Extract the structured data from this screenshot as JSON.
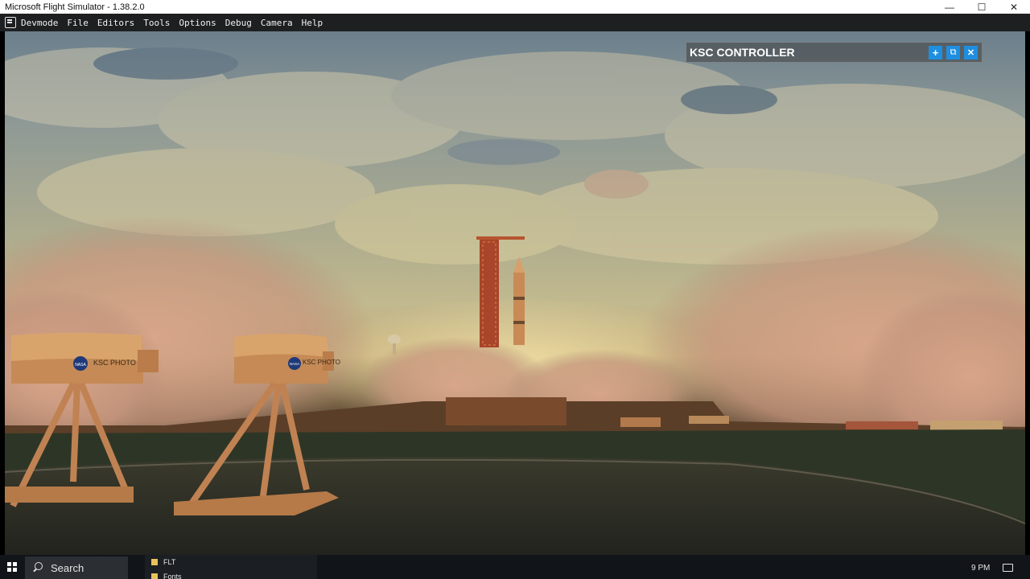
{
  "window": {
    "title": "Microsoft Flight Simulator - 1.38.2.0",
    "minimize_glyph": "—",
    "maximize_glyph": "☐",
    "close_glyph": "✕"
  },
  "menubar": {
    "items": [
      "Devmode",
      "File",
      "Editors",
      "Tools",
      "Options",
      "Debug",
      "Camera",
      "Help"
    ]
  },
  "ksc_panel": {
    "title": "KSC CONTROLLER",
    "add_glyph": "+",
    "popout_glyph": "⧉",
    "close_glyph": "✕"
  },
  "scene": {
    "camera_label_left": "KSC PHOTO",
    "camera_label_right": "KSC PHOTO",
    "agency_logo_text": "NASA"
  },
  "taskbar": {
    "search_placeholder": "Search",
    "files": [
      "FLT",
      "Fonts"
    ],
    "clock": "9 PM"
  },
  "colors": {
    "accent_button": "#1e8fe0",
    "menubar_bg": "#1d1f21",
    "taskbar_bg": "#111418"
  }
}
